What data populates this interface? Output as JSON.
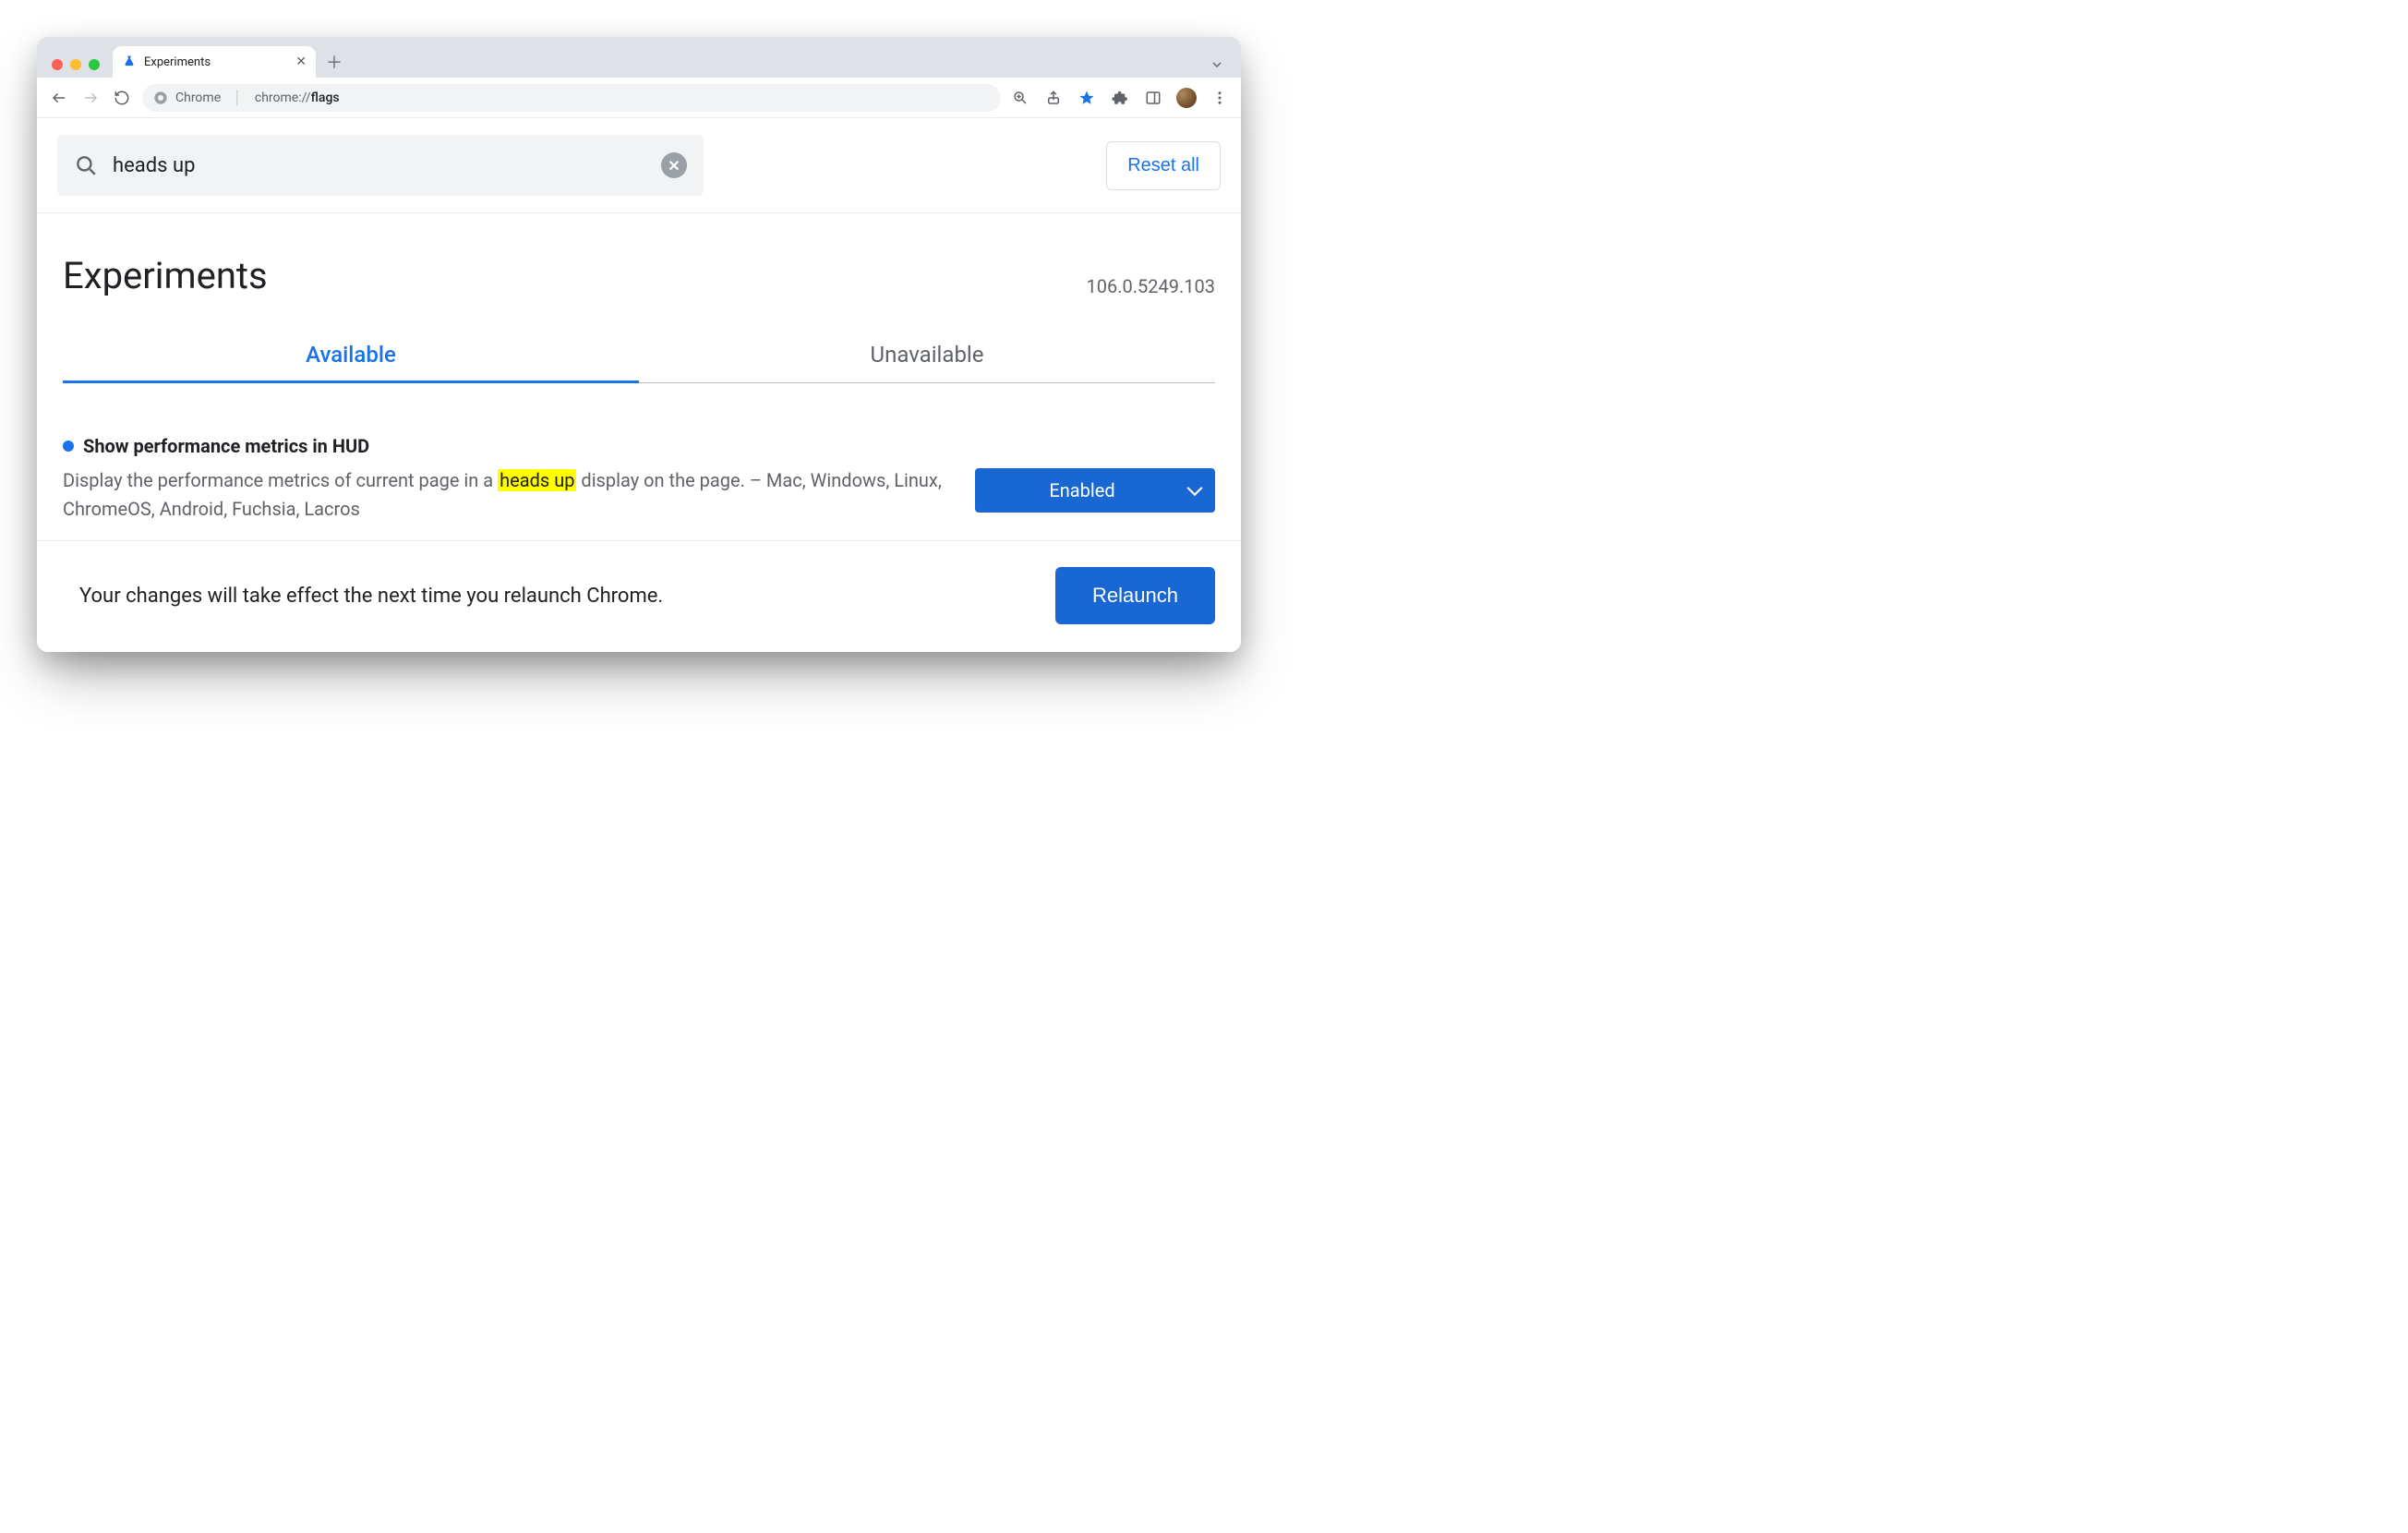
{
  "window": {
    "tab_title": "Experiments"
  },
  "omnibox": {
    "host_label": "Chrome",
    "url_scheme": "chrome://",
    "url_path": "flags"
  },
  "search": {
    "value": "heads up"
  },
  "reset_all_label": "Reset all",
  "page_title": "Experiments",
  "version": "106.0.5249.103",
  "tabs": {
    "available": "Available",
    "unavailable": "Unavailable"
  },
  "flag": {
    "title": "Show performance metrics in HUD",
    "desc_pre": "Display the performance metrics of current page in a ",
    "desc_hl": "heads up",
    "desc_post": " display on the page. – Mac, Windows, Linux, ChromeOS, Android, Fuchsia, Lacros",
    "select_value": "Enabled"
  },
  "relaunch": {
    "message": "Your changes will take effect the next time you relaunch Chrome.",
    "button": "Relaunch"
  }
}
